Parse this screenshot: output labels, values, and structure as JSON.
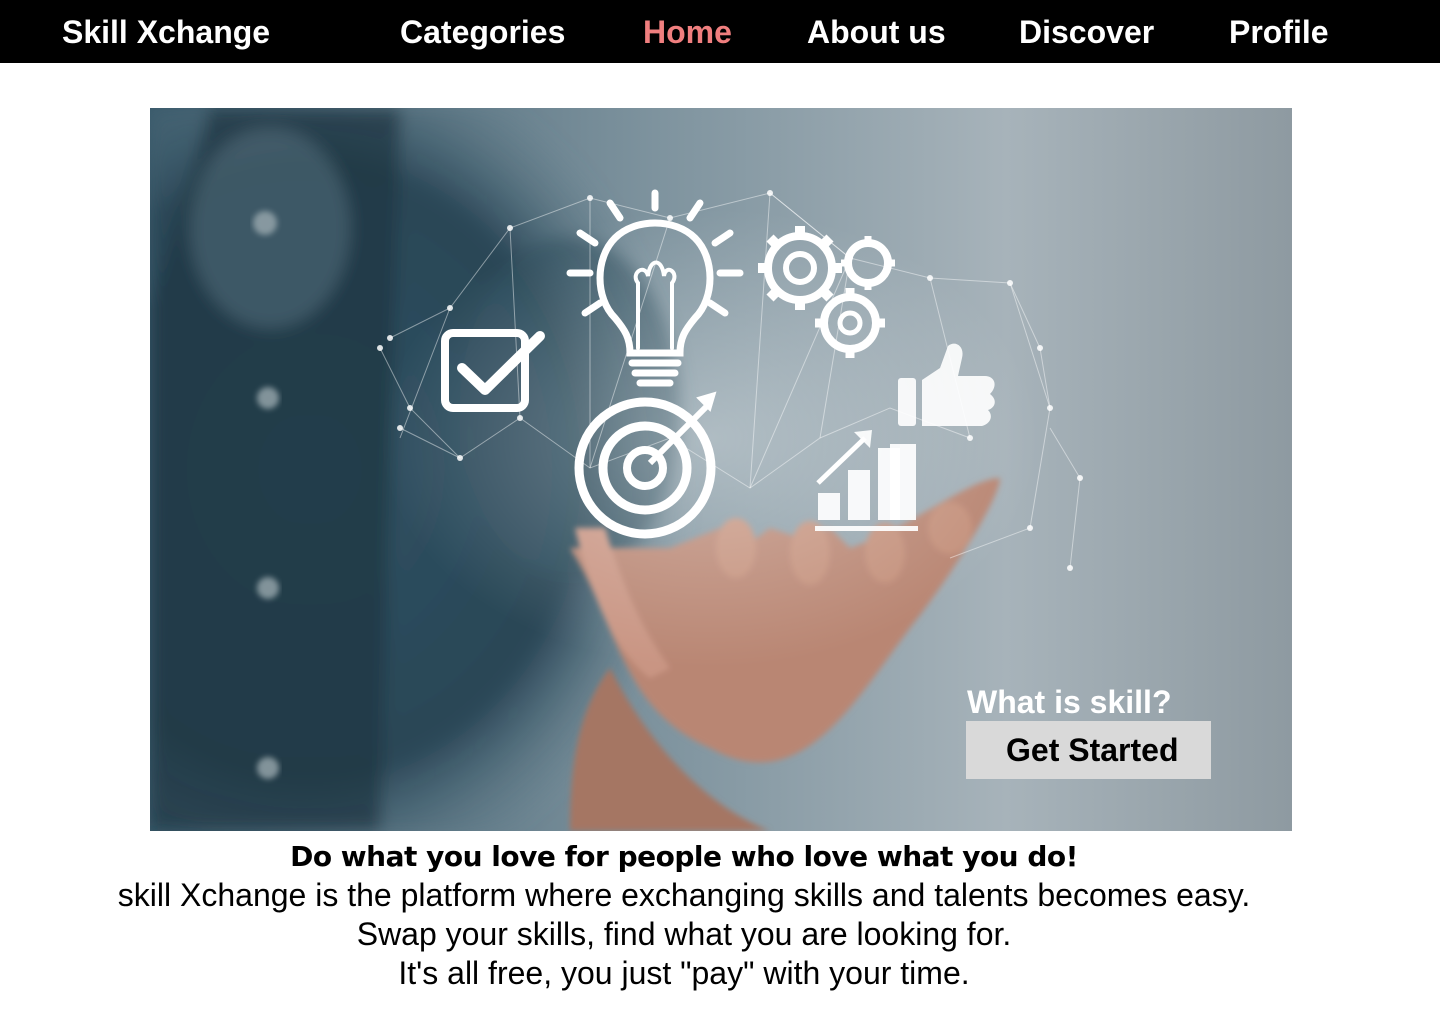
{
  "nav": {
    "brand": "Skill Xchange",
    "items": [
      {
        "label": "Categories",
        "active": false
      },
      {
        "label": "Home",
        "active": true
      },
      {
        "label": "About us",
        "active": false
      },
      {
        "label": "Discover",
        "active": false
      },
      {
        "label": "Profile",
        "active": false
      }
    ],
    "active_color": "#f07f7f"
  },
  "hero": {
    "image_icons": [
      "lightbulb-icon",
      "gears-icon",
      "checkbox-icon",
      "target-icon",
      "thumbs-up-icon",
      "bar-chart-icon"
    ],
    "question": "What is skill?",
    "cta_label": "Get Started"
  },
  "tagline": {
    "headline": "Do what you love for people who love what you do!",
    "lines": [
      "skill Xchange is the platform where exchanging skills and talents becomes easy.",
      "Swap your skills, find what you are looking for.",
      "It's all free, you just \"pay\" with your time."
    ]
  }
}
